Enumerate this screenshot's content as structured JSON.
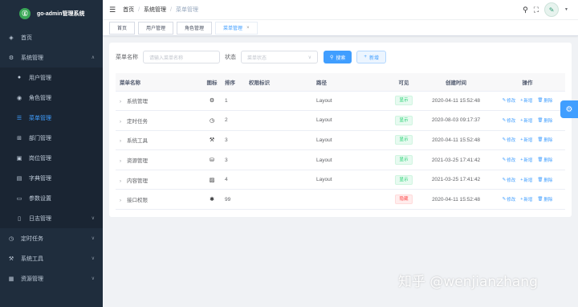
{
  "sidebar": {
    "logo_text": "go-admin管理系统",
    "logo_glyph": "ⓖ",
    "items": [
      {
        "label": "首页",
        "icon": "dashboard-icon",
        "glyph": "◈",
        "sub": false,
        "active": false,
        "arrow": ""
      },
      {
        "label": "系统管理",
        "icon": "system-icon",
        "glyph": "⚙",
        "sub": false,
        "active": false,
        "arrow": "∧"
      },
      {
        "label": "用户管理",
        "icon": "user-icon",
        "glyph": "●",
        "sub": true,
        "active": false,
        "arrow": ""
      },
      {
        "label": "角色管理",
        "icon": "role-icon",
        "glyph": "◉",
        "sub": true,
        "active": false,
        "arrow": ""
      },
      {
        "label": "菜单管理",
        "icon": "menu-list-icon",
        "glyph": "☰",
        "sub": true,
        "active": true,
        "arrow": ""
      },
      {
        "label": "部门管理",
        "icon": "department-icon",
        "glyph": "⊞",
        "sub": true,
        "active": false,
        "arrow": ""
      },
      {
        "label": "岗位管理",
        "icon": "post-icon",
        "glyph": "▣",
        "sub": true,
        "active": false,
        "arrow": ""
      },
      {
        "label": "字典管理",
        "icon": "dict-icon",
        "glyph": "▤",
        "sub": true,
        "active": false,
        "arrow": ""
      },
      {
        "label": "参数设置",
        "icon": "params-icon",
        "glyph": "▭",
        "sub": true,
        "active": false,
        "arrow": ""
      },
      {
        "label": "日志管理",
        "icon": "log-icon",
        "glyph": "▯",
        "sub": true,
        "active": false,
        "arrow": "∨"
      },
      {
        "label": "定时任务",
        "icon": "timer-icon",
        "glyph": "◷",
        "sub": false,
        "active": false,
        "arrow": "∨"
      },
      {
        "label": "系统工具",
        "icon": "tools-icon",
        "glyph": "⚒",
        "sub": false,
        "active": false,
        "arrow": "∨"
      },
      {
        "label": "资源管理",
        "icon": "resource-icon",
        "glyph": "▦",
        "sub": false,
        "active": false,
        "arrow": "∨"
      }
    ]
  },
  "topbar": {
    "hamburger": "☰",
    "breadcrumbs": [
      "首页",
      "系统管理",
      "菜单管理"
    ],
    "separator": "/",
    "search_glyph": "⚲",
    "fullscreen_glyph": "⛶",
    "avatar_glyph": "✎",
    "caret": "▼"
  },
  "tags": [
    {
      "label": "首页",
      "active": false
    },
    {
      "label": "用户管理",
      "active": false
    },
    {
      "label": "角色管理",
      "active": false
    },
    {
      "label": "菜单管理",
      "active": true,
      "close": "×"
    }
  ],
  "filter": {
    "name_label": "菜单名称",
    "name_placeholder": "请输入菜单名称",
    "status_label": "状态",
    "status_placeholder": "菜单状态",
    "status_caret": "∨",
    "search_button": "搜索",
    "search_glyph": "⚲",
    "add_button": "新增",
    "add_glyph": "+"
  },
  "table": {
    "headers": [
      "菜单名称",
      "图标",
      "排序",
      "权限标识",
      "路径",
      "可见",
      "创建时间",
      "操作"
    ],
    "expand_glyph": "›",
    "ops": {
      "edit": "修改",
      "add": "新增",
      "delete": "删除",
      "edit_glyph": "✎",
      "add_glyph": "+",
      "delete_glyph": "🗑"
    },
    "rows": [
      {
        "name": "系统管理",
        "icon": "gear-icon",
        "glyph": "⚙",
        "sort": "1",
        "perm": "",
        "path": "Layout",
        "visible": "显示",
        "visible_ok": true,
        "time": "2020-04-11 15:52:48"
      },
      {
        "name": "定时任务",
        "icon": "timer-icon",
        "glyph": "◷",
        "sort": "2",
        "perm": "",
        "path": "Layout",
        "visible": "显示",
        "visible_ok": true,
        "time": "2020-08-03 09:17:37"
      },
      {
        "name": "系统工具",
        "icon": "tools-icon",
        "glyph": "⚒",
        "sort": "3",
        "perm": "",
        "path": "Layout",
        "visible": "显示",
        "visible_ok": true,
        "time": "2020-04-11 15:52:48"
      },
      {
        "name": "资源管理",
        "icon": "database-icon",
        "glyph": "⛁",
        "sort": "3",
        "perm": "",
        "path": "Layout",
        "visible": "显示",
        "visible_ok": true,
        "time": "2021-03-25 17:41:42"
      },
      {
        "name": "内容管理",
        "icon": "chart-icon",
        "glyph": "▨",
        "sort": "4",
        "perm": "",
        "path": "Layout",
        "visible": "显示",
        "visible_ok": true,
        "time": "2021-03-25 17:41:42"
      },
      {
        "name": "接口权限",
        "icon": "bug-icon",
        "glyph": "✱",
        "sort": "99",
        "perm": "",
        "path": "",
        "visible": "隐藏",
        "visible_ok": false,
        "time": "2020-04-11 15:52:48"
      }
    ]
  },
  "settings_glyph": "⚙",
  "watermark": "知乎 @wenjianzhang"
}
